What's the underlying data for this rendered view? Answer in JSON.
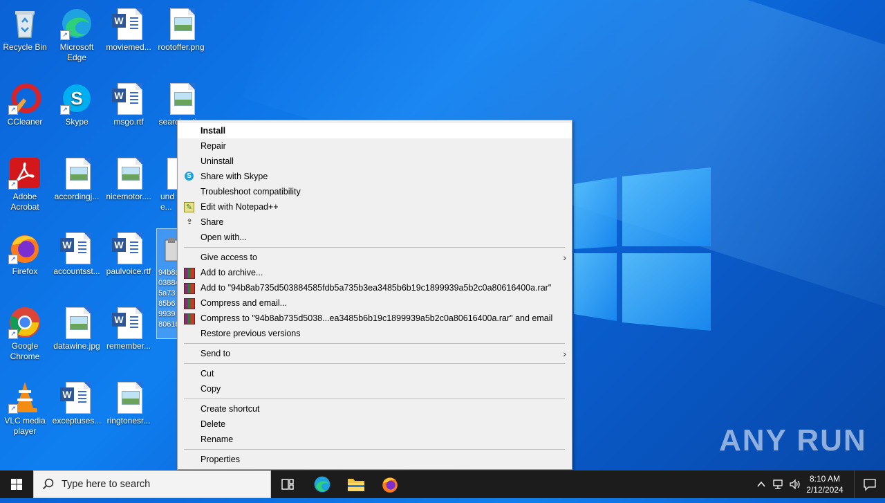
{
  "desktop": {
    "icons": [
      {
        "label": "Recycle Bin"
      },
      {
        "label": "Microsoft Edge"
      },
      {
        "label": "moviemed..."
      },
      {
        "label": "rootoffer.png"
      },
      {
        "label": "CCleaner"
      },
      {
        "label": "Skype"
      },
      {
        "label": "msgo.rtf"
      },
      {
        "label": "searchesti..."
      },
      {
        "label": "Adobe Acrobat"
      },
      {
        "label": "accordingj..."
      },
      {
        "label": "nicemotor...."
      },
      {
        "label": "unde..."
      },
      {
        "label": "Firefox"
      },
      {
        "label": "accountsst..."
      },
      {
        "label": "paulvoice.rtf"
      },
      {
        "label": "Google Chrome"
      },
      {
        "label": "datawine.jpg"
      },
      {
        "label": "remember..."
      },
      {
        "label": "VLC media player"
      },
      {
        "label": "exceptuses..."
      },
      {
        "label": "ringtonesr..."
      }
    ],
    "selected_partial": "94b8a\n03884\n5a73\n85b6\n9939\n80616"
  },
  "menu": {
    "install": "Install",
    "repair": "Repair",
    "uninstall": "Uninstall",
    "share_skype": "Share with Skype",
    "troubleshoot": "Troubleshoot compatibility",
    "notepad": "Edit with Notepad++",
    "share": "Share",
    "open_with": "Open with...",
    "give_access": "Give access to",
    "add_archive": "Add to archive...",
    "add_to_rar": "Add to \"94b8ab735d503884585fdb5a735b3ea3485b6b19c1899939a5b2c0a80616400a.rar\"",
    "compress_email": "Compress and email...",
    "compress_to_rar_email": "Compress to \"94b8ab735d5038...ea3485b6b19c1899939a5b2c0a80616400a.rar\" and email",
    "restore": "Restore previous versions",
    "send_to": "Send to",
    "cut": "Cut",
    "copy": "Copy",
    "create_shortcut": "Create shortcut",
    "delete": "Delete",
    "rename": "Rename",
    "properties": "Properties"
  },
  "watermark": "ANY RUN",
  "taskbar": {
    "search_placeholder": "Type here to search",
    "time": "8:10 AM",
    "date": "2/12/2024"
  },
  "colors": {
    "taskbar": "#1c1c1c",
    "desktop": "#0f7ff0",
    "menu_bg": "#f0f0f0"
  }
}
